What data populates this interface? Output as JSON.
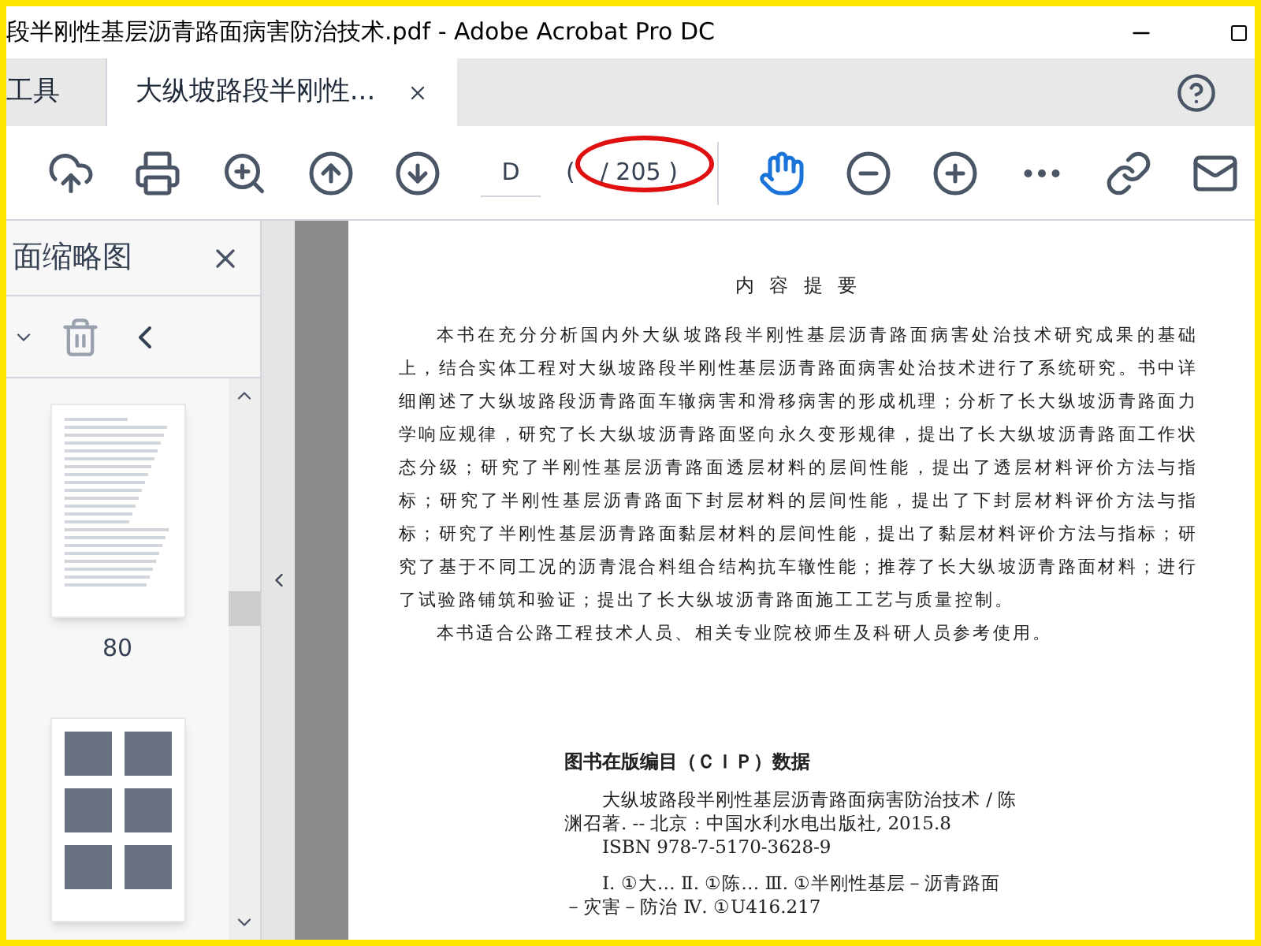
{
  "window": {
    "title": "段半刚性基层沥青路面病害防治技术.pdf - Adobe Acrobat Pro DC"
  },
  "tabs": [
    {
      "label": "工具",
      "selected": false,
      "closable": false
    },
    {
      "label": "大纵坡路段半刚性...",
      "selected": true,
      "closable": true
    }
  ],
  "toolbar": {
    "page_field": "D",
    "page_open": "(",
    "page_total": "/ 205 )"
  },
  "sidebar": {
    "title": "面缩略图",
    "thumbnails": [
      {
        "kind": "text",
        "label": "80"
      },
      {
        "kind": "photos"
      }
    ]
  },
  "document": {
    "heading": "内 容 提 要",
    "paragraphs": [
      "本书在充分分析国内外大纵坡路段半刚性基层沥青路面病害处治技术研究成果的基础上，结合实体工程对大纵坡路段半刚性基层沥青路面病害处治技术进行了系统研究。书中详细阐述了大纵坡路段沥青路面车辙病害和滑移病害的形成机理；分析了长大纵坡沥青路面力学响应规律，研究了长大纵坡沥青路面竖向永久变形规律，提出了长大纵坡沥青路面工作状态分级；研究了半刚性基层沥青路面透层材料的层间性能，提出了透层材料评价方法与指标；研究了半刚性基层沥青路面下封层材料的层间性能，提出了下封层材料评价方法与指标；研究了半刚性基层沥青路面黏层材料的层间性能，提出了黏层材料评价方法与指标；研究了基于不同工况的沥青混合料组合结构抗车辙性能；推荐了长大纵坡沥青路面材料；进行了试验路铺筑和验证；提出了长大纵坡沥青路面施工工艺与质量控制。",
      "本书适合公路工程技术人员、相关专业院校师生及科研人员参考使用。"
    ],
    "cip_heading": "图书在版编目（ＣＩＰ）数据",
    "cip_lines": [
      "大纵坡路段半刚性基层沥青路面病害防治技术 / 陈渊召著. -- 北京 : 中国水利水电出版社, 2015.8",
      "ISBN 978-7-5170-3628-9",
      "Ⅰ. ①大… Ⅱ. ①陈… Ⅲ. ①半刚性基层－沥青路面",
      "－灾害－防治 Ⅳ. ①U416.217"
    ]
  }
}
